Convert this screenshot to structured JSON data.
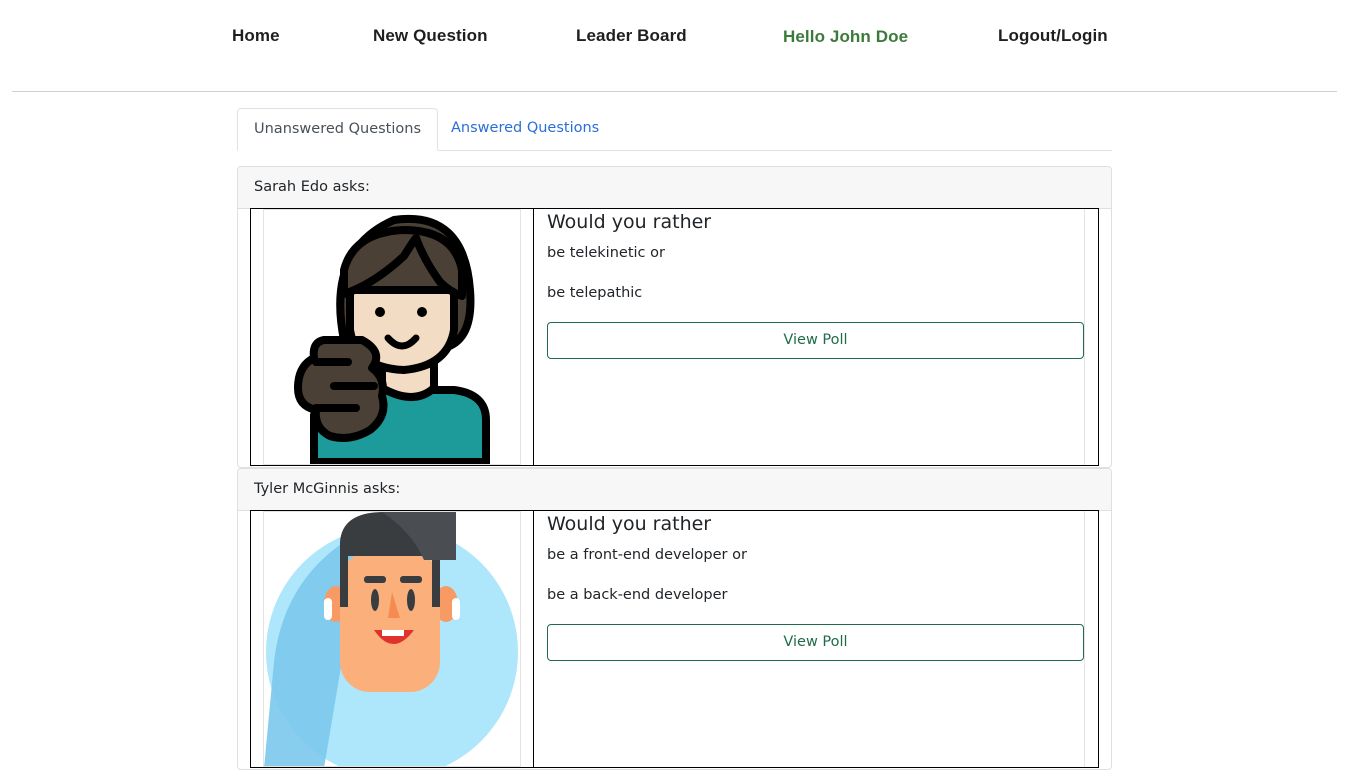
{
  "nav": {
    "home": "Home",
    "new_question": "New Question",
    "leader_board": "Leader Board",
    "greeting": "Hello John Doe",
    "auth": "Logout/Login"
  },
  "tabs": {
    "unanswered": "Unanswered Questions",
    "answered": "Answered Questions"
  },
  "questions": [
    {
      "author_line": "Sarah Edo asks:",
      "title": "Would you rather",
      "option_one": "be telekinetic or",
      "option_two": "be telepathic",
      "button": "View Poll",
      "avatar_icon": "woman-avatar-icon"
    },
    {
      "author_line": "Tyler McGinnis asks:",
      "title": "Would you rather",
      "option_one": "be a front-end developer or",
      "option_two": "be a back-end developer",
      "button": "View Poll",
      "avatar_icon": "man-avatar-icon"
    }
  ],
  "colors": {
    "greeting": "#3c7a3c",
    "tab_link": "#2a6fd6",
    "button_border": "#1f6b4a",
    "hair_woman": "#4a4036",
    "shirt_woman": "#1d9a9a",
    "skin": "#f3dcc4",
    "bg_man": "#aee6fb",
    "hair_man": "#3a3d40",
    "skin_man": "#fbb07c"
  }
}
